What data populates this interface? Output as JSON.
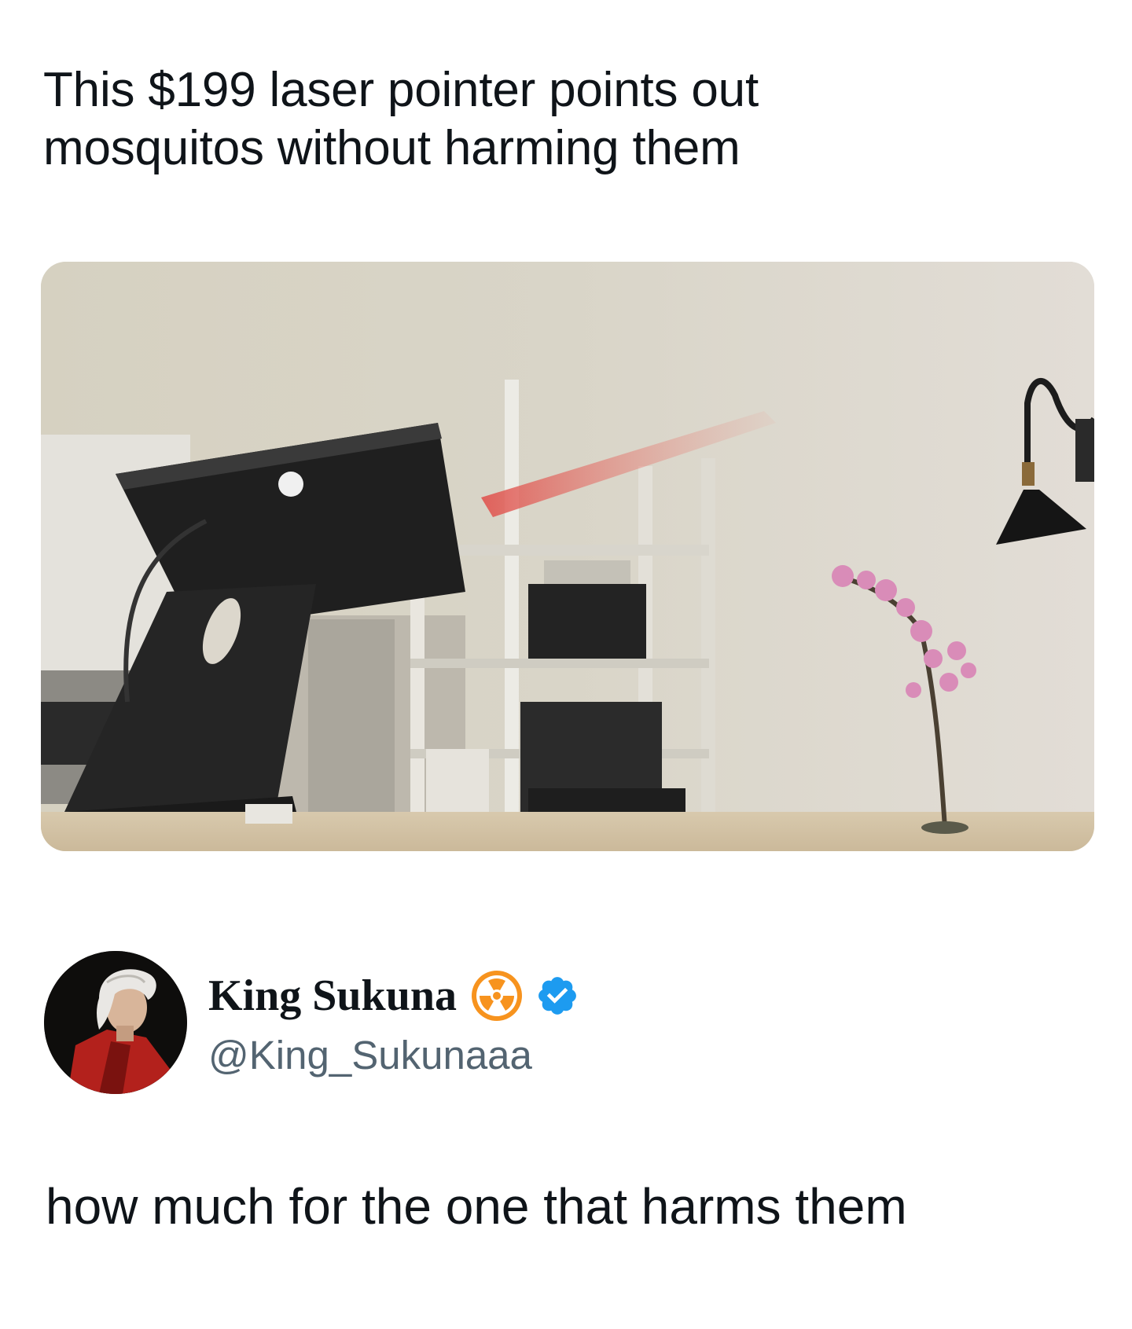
{
  "quoted_post": {
    "text_line1": "This $199 laser pointer points out",
    "text_line2": "mosquitos without harming them",
    "media": {
      "icon": "photo",
      "description_shown": false
    }
  },
  "reply": {
    "author": {
      "display_name": "King Sukuna",
      "handle": "@King_Sukunaaa",
      "emoji_badge_icon": "radioactive-icon",
      "verified_icon": "verified-check-icon",
      "verified_color": "#1d9bf0",
      "emoji_badge_color": "#f7931e"
    },
    "text": "how much for the one that harms them"
  },
  "colors": {
    "text_primary": "#0f1419",
    "text_secondary": "#536471",
    "background": "#ffffff"
  }
}
